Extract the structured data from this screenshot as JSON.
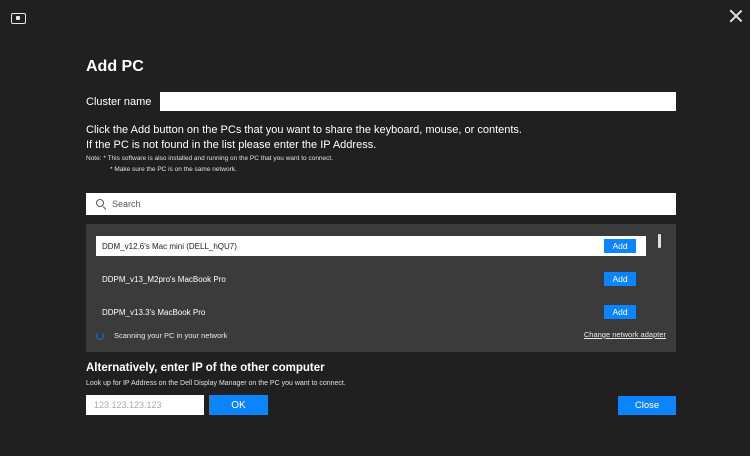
{
  "window": {
    "app_icon": "monitor-icon",
    "close_icon": "close-icon"
  },
  "title": "Add PC",
  "cluster": {
    "label": "Cluster name",
    "value": ""
  },
  "instructions": {
    "line1": "Click the Add button on the PCs that you want to share the keyboard, mouse, or contents.",
    "line2": "If the PC is not found in the list please enter the IP Address.",
    "note1": "Note:  * This software is also installed and running on the PC that you want to connect.",
    "note2": "* Make sure the PC is on the same network."
  },
  "search": {
    "placeholder": "Search",
    "icon": "search-icon"
  },
  "pc_list": {
    "items": [
      {
        "name": "DDM_v12.6's Mac mini (DELL_hQU7)",
        "action": "Add"
      },
      {
        "name": "DDPM_v13_M2pro's MacBook Pro",
        "action": "Add"
      },
      {
        "name": "DDPM_v13.3's MacBook Pro",
        "action": "Add"
      }
    ],
    "scan_status": "Scanning your PC in your network",
    "change_adapter": "Change network adapter"
  },
  "alternative": {
    "title": "Alternatively, enter IP of the other computer",
    "description": "Look up for IP Address on the Dell Display Manager on the PC you want to connect.",
    "ip_placeholder": "123.123.123.123",
    "ok_label": "OK"
  },
  "footer": {
    "close_label": "Close"
  },
  "colors": {
    "background": "#202020",
    "panel": "#3b3b3b",
    "accent": "#0a84ff"
  }
}
